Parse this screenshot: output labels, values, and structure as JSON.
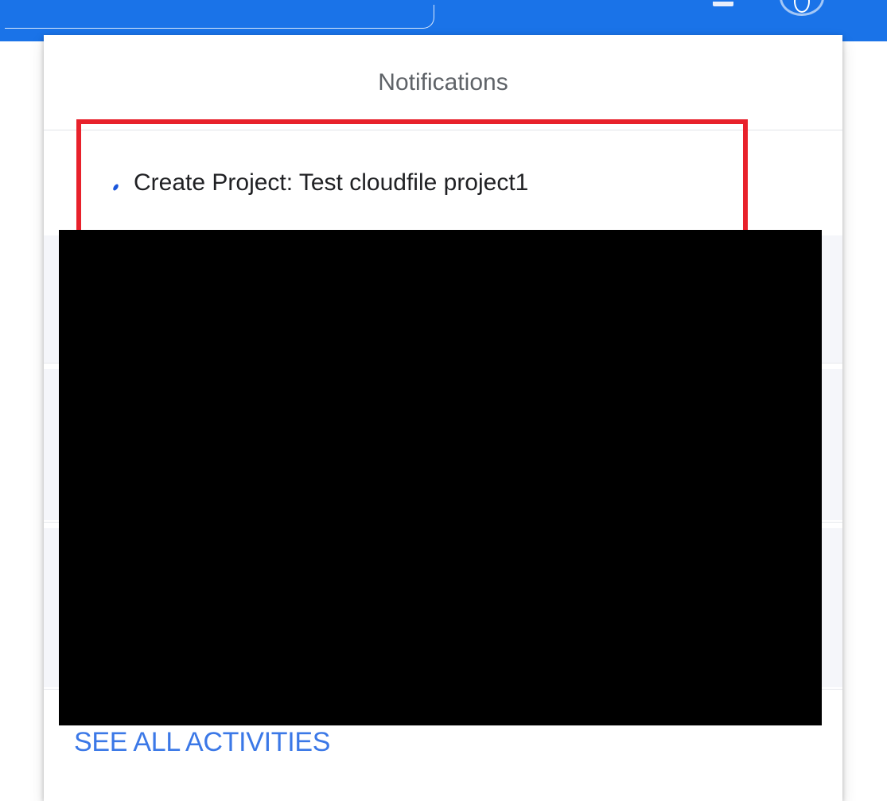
{
  "notifications": {
    "title": "Notifications",
    "items": [
      {
        "text": "Create Project: Test cloudfile project1"
      }
    ],
    "see_all_label": "SEE ALL ACTIVITIES"
  },
  "colors": {
    "appbar": "#1a73e8",
    "highlight": "#e8212b",
    "link": "#3b78e7"
  },
  "icons": {
    "unread_indicator": "unread-dot-icon",
    "account": "account-circle-icon"
  }
}
